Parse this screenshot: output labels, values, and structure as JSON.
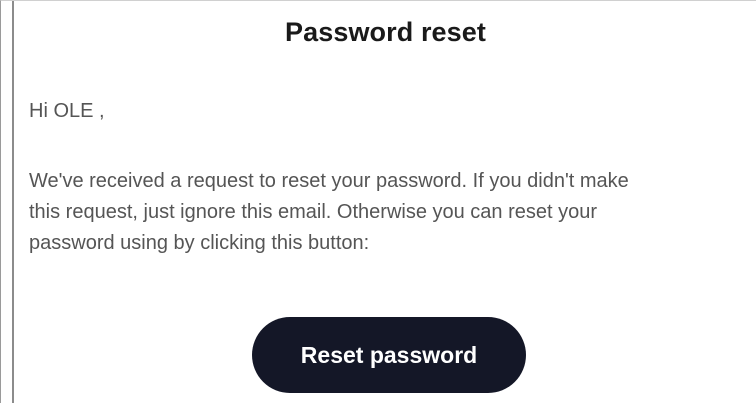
{
  "email": {
    "title": "Password reset",
    "greeting": "Hi OLE ,",
    "body_lines": [
      "We've received a request to reset your password. If you didn't make",
      "this request, just ignore this email. Otherwise you can reset your",
      "password using by clicking this button:"
    ],
    "button_label": "Reset password"
  },
  "colors": {
    "button_background": "#141727",
    "button_text": "#ffffff",
    "body_text": "#555555",
    "title_text": "#1a1a1a"
  }
}
